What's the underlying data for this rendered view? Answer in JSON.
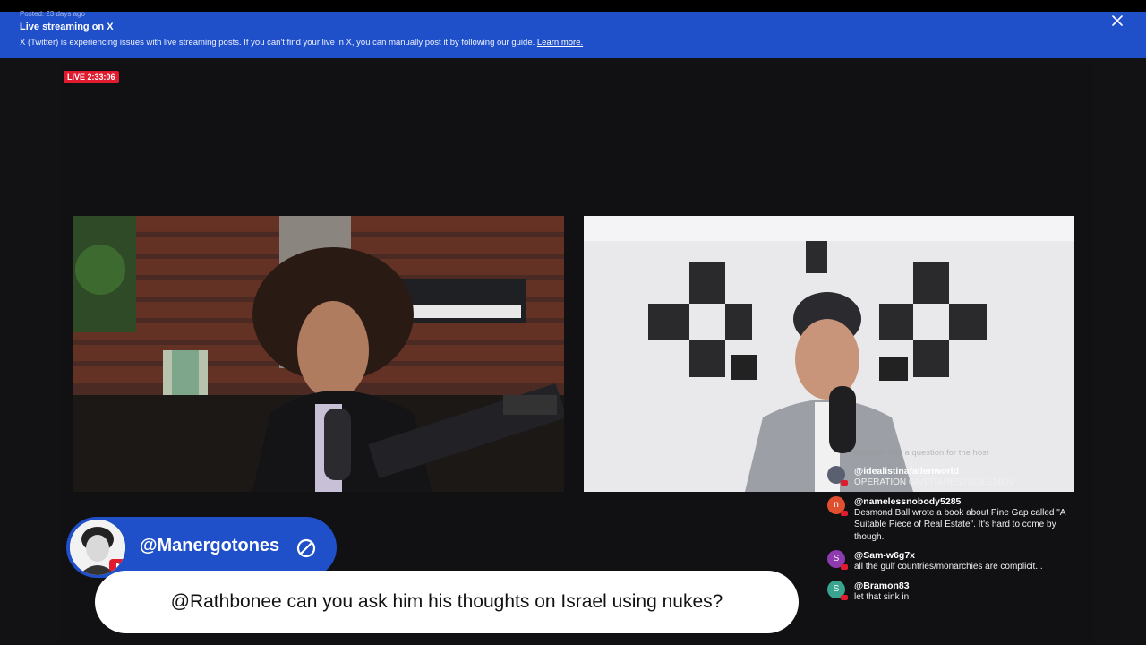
{
  "banner": {
    "posted": "Posted: 23 days ago",
    "title": "Live streaming on X",
    "message": "X (Twitter) is experiencing issues with live streaming posts. If you can't find your live in X, you can manually post it by following our guide.",
    "link": "Learn more.",
    "close_icon": "close-icon"
  },
  "live_badge": "LIVE 2:33:06",
  "ticker": "markvas has a question for the host",
  "chat": [
    {
      "user": "@idealistinafallenworld",
      "text": "OPERATION GIVEITARESTSUILEMAN",
      "avatar": "",
      "color": "#5a6070"
    },
    {
      "user": "@namelessnobody5285",
      "text": "Desmond Ball wrote a book about Pine Gap called \"A Suitable Piece of Real Estate\". It's hard to come by though.",
      "avatar": "n",
      "color": "#e0502e"
    },
    {
      "user": "@Sam-w6g7x",
      "text": "all the gulf countries/monarchies are complicit...",
      "avatar": "S",
      "color": "#8e3bb0"
    },
    {
      "user": "@Bramon83",
      "text": "let that sink in",
      "avatar": "S",
      "color": "#3aa58e"
    }
  ],
  "featured": {
    "username": "@Manergotones",
    "message": "@Rathbonee can you ask him his thoughts on Israel using nukes?"
  },
  "colors": {
    "banner": "#1f4fc9",
    "live": "#e01b2e",
    "background": "#121214"
  }
}
